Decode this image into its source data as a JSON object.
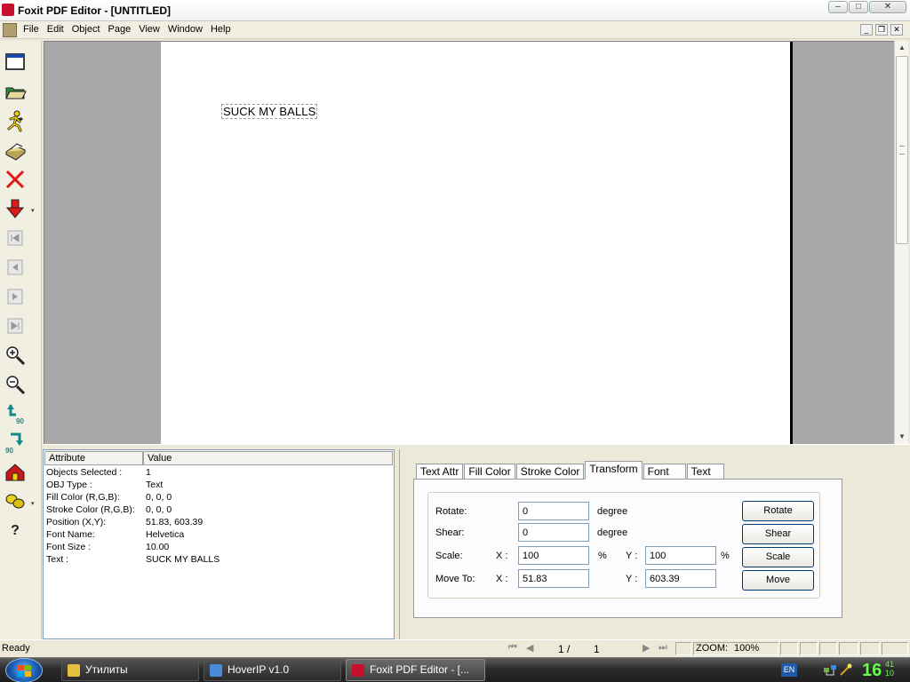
{
  "window": {
    "title": "Foxit PDF Editor - [UNTITLED]"
  },
  "menu": {
    "items": [
      "File",
      "Edit",
      "Object",
      "Page",
      "View",
      "Window",
      "Help"
    ]
  },
  "toolbar": {
    "tools": [
      "new-window-icon",
      "open-folder-icon",
      "running-man-icon",
      "print-icon",
      "delete-icon",
      "import-arrow-icon",
      "first-page-icon",
      "prev-page-icon",
      "next-page-icon",
      "last-page-icon",
      "zoom-in-icon",
      "zoom-out-icon",
      "rotate-left-90-icon",
      "rotate-right-90-icon",
      "home-icon",
      "group-icon",
      "help-icon"
    ],
    "rotate_left_label": "90",
    "rotate_right_label": "90",
    "help_label": "?"
  },
  "document": {
    "text_object": "SUCK MY BALLS"
  },
  "properties": {
    "header": {
      "attribute": "Attribute",
      "value": "Value"
    },
    "rows": [
      {
        "key": "Objects Selected :",
        "value": "1"
      },
      {
        "key": "OBJ Type :",
        "value": "Text"
      },
      {
        "key": "Fill Color (R,G,B):",
        "value": "0, 0, 0"
      },
      {
        "key": "Stroke Color (R,G,B):",
        "value": "0, 0, 0"
      },
      {
        "key": "Position (X,Y):",
        "value": "51.83, 603.39"
      },
      {
        "key": "Font Name:",
        "value": "Helvetica"
      },
      {
        "key": "Font Size :",
        "value": "10.00"
      },
      {
        "key": "Text :",
        "value": "SUCK MY BALLS"
      }
    ]
  },
  "transform": {
    "tabs": [
      "Text Attr",
      "Fill Color",
      "Stroke Color",
      "Transform",
      "Font",
      "Text"
    ],
    "active_tab": "Transform",
    "rotate": {
      "label": "Rotate:",
      "value": "0",
      "unit": "degree",
      "button": "Rotate"
    },
    "shear": {
      "label": "Shear:",
      "value": "0",
      "unit": "degree",
      "button": "Shear"
    },
    "scale": {
      "label": "Scale:",
      "x_label": "X :",
      "x_value": "100",
      "x_unit": "%",
      "y_label": "Y :",
      "y_value": "100",
      "y_unit": "%",
      "button": "Scale"
    },
    "move": {
      "label": "Move To:",
      "x_label": "X :",
      "x_value": "51.83",
      "y_label": "Y :",
      "y_value": "603.39",
      "button": "Move"
    }
  },
  "status": {
    "text": "Ready",
    "page_current": "1 /",
    "page_total": "1",
    "zoom_label": "ZOOM:",
    "zoom_value": "100%"
  },
  "taskbar": {
    "tasks": [
      "Утилиты",
      "HoverIP v1.0",
      "Foxit PDF Editor - [..."
    ],
    "language": "EN",
    "clock_hour": "16",
    "clock_min": "41",
    "clock_sec": "10"
  },
  "colors": {
    "accent": "#0b5aa8",
    "clock": "#62ff42",
    "page_bg": "#ffffff",
    "workspace": "#a8a8a8"
  }
}
